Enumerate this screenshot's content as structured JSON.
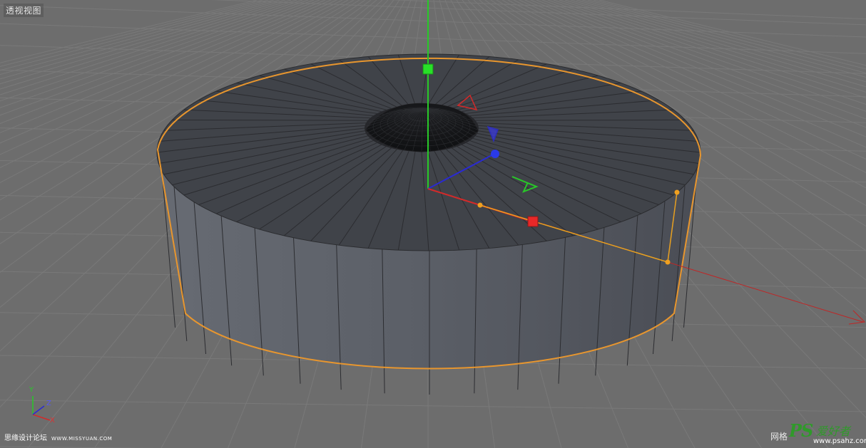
{
  "viewport": {
    "label": "透视视图"
  },
  "axis_widget": {
    "y": "Y",
    "z": "Z",
    "x": "X"
  },
  "watermark_left": {
    "text": "思缘设计论坛",
    "site": "WWW.MISSYUAN.COM"
  },
  "watermark_right": {
    "prefix": "网格",
    "logo": "PS",
    "chinese": "爱好者",
    "url": "www.psahz.com"
  },
  "colors": {
    "background": "#6d6d6d",
    "grid": "#7e7e7e",
    "selection_outline": "#e8962e",
    "axis_x": "#d22a2a",
    "axis_y": "#28c828",
    "axis_z": "#2a2ad2",
    "object_side": "#5a5e66",
    "object_top": "#3e4147"
  }
}
